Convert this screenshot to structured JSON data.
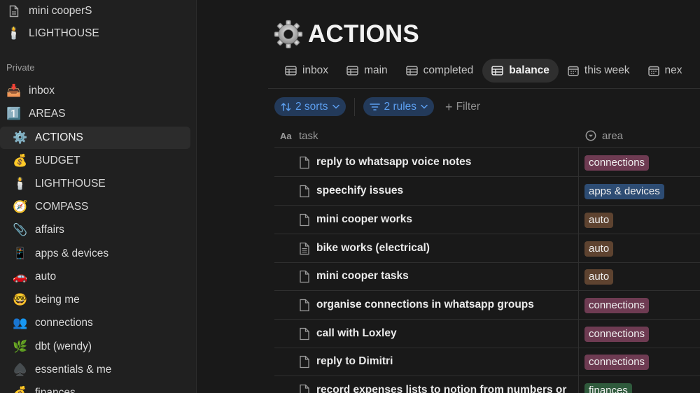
{
  "sidebar": {
    "top_items": [
      {
        "label": "mini cooperS",
        "icon": "document-icon"
      },
      {
        "label": "LIGHTHOUSE",
        "icon": "lighthouse-icon"
      }
    ],
    "section_label": "Private",
    "items": [
      {
        "label": "inbox",
        "icon": "inbox-tray-icon",
        "glyph": "📥"
      },
      {
        "label": "AREAS",
        "icon": "keycap-one-icon",
        "glyph": "1️⃣"
      },
      {
        "label": "ACTIONS",
        "icon": "gear-icon",
        "glyph": "⚙️",
        "active": true
      },
      {
        "label": "BUDGET",
        "icon": "money-bag-icon",
        "glyph": "💰"
      },
      {
        "label": "LIGHTHOUSE",
        "icon": "lighthouse-icon",
        "glyph": "🕯️"
      },
      {
        "label": "COMPASS",
        "icon": "compass-icon",
        "glyph": "🧭"
      },
      {
        "label": "affairs",
        "icon": "paperclip-icon",
        "glyph": "📎"
      },
      {
        "label": "apps & devices",
        "icon": "mobile-phone-icon",
        "glyph": "📱"
      },
      {
        "label": "auto",
        "icon": "car-icon",
        "glyph": "🚗"
      },
      {
        "label": "being me",
        "icon": "nerd-face-icon",
        "glyph": "🤓"
      },
      {
        "label": "connections",
        "icon": "people-icon",
        "glyph": "👥"
      },
      {
        "label": "dbt (wendy)",
        "icon": "herb-icon",
        "glyph": "🌿"
      },
      {
        "label": "essentials & me",
        "icon": "spade-icon",
        "glyph": "♠️"
      },
      {
        "label": "finances",
        "icon": "money-bag-icon",
        "glyph": "💰"
      }
    ]
  },
  "page": {
    "title": "ACTIONS",
    "title_icon": "gear-icon"
  },
  "tabs": [
    {
      "label": "inbox",
      "icon": "table-icon"
    },
    {
      "label": "main",
      "icon": "table-icon"
    },
    {
      "label": "completed",
      "icon": "table-icon"
    },
    {
      "label": "balance",
      "icon": "table-icon",
      "active": true
    },
    {
      "label": "this week",
      "icon": "calendar-icon"
    },
    {
      "label": "nex",
      "icon": "calendar-icon"
    }
  ],
  "toolbar": {
    "sorts_label": "2 sorts",
    "rules_label": "2 rules",
    "filter_label": "Filter"
  },
  "table": {
    "columns": [
      {
        "label": "task",
        "icon": "text-property-icon"
      },
      {
        "label": "area",
        "icon": "select-property-icon"
      }
    ],
    "rows": [
      {
        "task": "reply to whatsapp voice notes",
        "area": "connections",
        "area_color": "#6e3b52"
      },
      {
        "task": "speechify issues",
        "area": "apps & devices",
        "area_color": "#2d4c73"
      },
      {
        "task": "mini cooper works",
        "area": "auto",
        "area_color": "#5e4330"
      },
      {
        "task": "bike works (electrical)",
        "area": "auto",
        "area_color": "#5e4330"
      },
      {
        "task": "mini cooper tasks",
        "area": "auto",
        "area_color": "#5e4330"
      },
      {
        "task": "organise connections in whatsapp groups",
        "area": "connections",
        "area_color": "#6e3b52"
      },
      {
        "task": "call with Loxley",
        "area": "connections",
        "area_color": "#6e3b52"
      },
      {
        "task": "reply to Dimitri",
        "area": "connections",
        "area_color": "#6e3b52"
      },
      {
        "task": "record expenses lists to notion from numbers or",
        "area": "finances",
        "area_color": "#2f5a3c"
      }
    ]
  },
  "colors": {
    "background": "#191919",
    "sidebar": "#202020",
    "accent_blue": "#5c9ff0",
    "pill_background": "#233a5a"
  }
}
